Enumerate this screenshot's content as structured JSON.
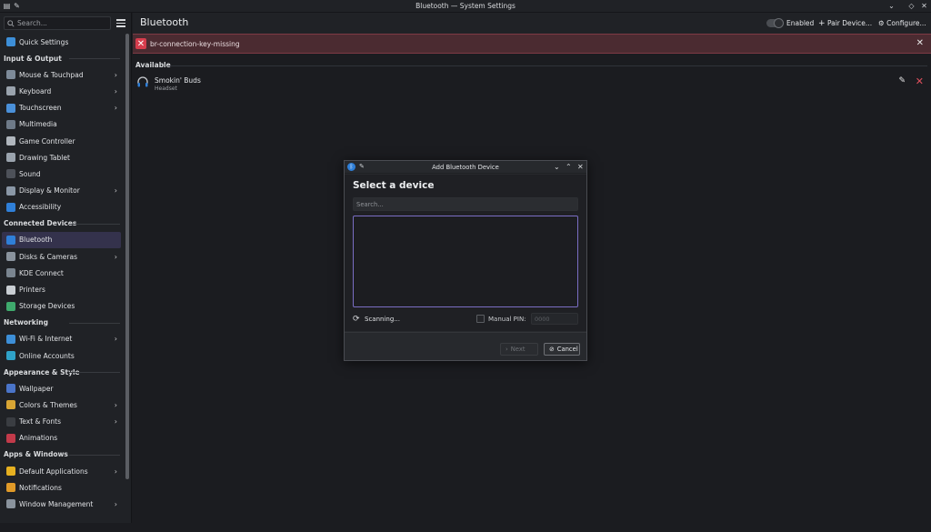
{
  "window": {
    "title": "Bluetooth — System Settings"
  },
  "sidebar": {
    "search_placeholder": "Search...",
    "groups": [
      {
        "section": "",
        "items": [
          {
            "label": "Quick Settings",
            "icon": "quick-settings-icon",
            "color": "#3d8fd8",
            "chevron": false
          }
        ]
      },
      {
        "section": "Input & Output",
        "items": [
          {
            "label": "Mouse & Touchpad",
            "icon": "mouse-icon",
            "color": "#7d8a99",
            "chevron": true
          },
          {
            "label": "Keyboard",
            "icon": "keyboard-icon",
            "color": "#9aa3ad",
            "chevron": true
          },
          {
            "label": "Touchscreen",
            "icon": "touchscreen-icon",
            "color": "#4a90d9",
            "chevron": true
          },
          {
            "label": "Multimedia",
            "icon": "multimedia-icon",
            "color": "#6e7a88",
            "chevron": false
          },
          {
            "label": "Game Controller",
            "icon": "gamepad-icon",
            "color": "#b0b6bd",
            "chevron": false
          },
          {
            "label": "Drawing Tablet",
            "icon": "tablet-icon",
            "color": "#9aa3ad",
            "chevron": false
          },
          {
            "label": "Sound",
            "icon": "sound-icon",
            "color": "#4d5159",
            "chevron": false
          },
          {
            "label": "Display & Monitor",
            "icon": "monitor-icon",
            "color": "#8a97a6",
            "chevron": true
          },
          {
            "label": "Accessibility",
            "icon": "accessibility-icon",
            "color": "#2f7fd8",
            "chevron": false
          }
        ]
      },
      {
        "section": "Connected Devices",
        "items": [
          {
            "label": "Bluetooth",
            "icon": "bluetooth-icon",
            "color": "#2f7fd8",
            "chevron": false,
            "active": true
          },
          {
            "label": "Disks & Cameras",
            "icon": "disk-icon",
            "color": "#8a939d",
            "chevron": true
          },
          {
            "label": "KDE Connect",
            "icon": "kde-connect-icon",
            "color": "#7a8590",
            "chevron": false
          },
          {
            "label": "Printers",
            "icon": "printer-icon",
            "color": "#c9ced3",
            "chevron": false
          },
          {
            "label": "Storage Devices",
            "icon": "storage-icon",
            "color": "#3faa6d",
            "chevron": false
          }
        ]
      },
      {
        "section": "Networking",
        "items": [
          {
            "label": "Wi-Fi & Internet",
            "icon": "network-icon",
            "color": "#3d8fd8",
            "chevron": true
          },
          {
            "label": "Online Accounts",
            "icon": "online-accounts-icon",
            "color": "#2fa2c8",
            "chevron": false
          }
        ]
      },
      {
        "section": "Appearance & Style",
        "items": [
          {
            "label": "Wallpaper",
            "icon": "wallpaper-icon",
            "color": "#4a74c9",
            "chevron": false
          },
          {
            "label": "Colors & Themes",
            "icon": "colors-icon",
            "color": "#d8a534",
            "chevron": true
          },
          {
            "label": "Text & Fonts",
            "icon": "fonts-icon",
            "color": "#3a3d42",
            "chevron": true
          },
          {
            "label": "Animations",
            "icon": "animations-icon",
            "color": "#c23a4a",
            "chevron": false
          }
        ]
      },
      {
        "section": "Apps & Windows",
        "items": [
          {
            "label": "Default Applications",
            "icon": "star-icon",
            "color": "#e6b020",
            "chevron": true
          },
          {
            "label": "Notifications",
            "icon": "bell-icon",
            "color": "#e09a28",
            "chevron": false
          },
          {
            "label": "Window Management",
            "icon": "window-icon",
            "color": "#8a939d",
            "chevron": true
          }
        ]
      }
    ]
  },
  "header": {
    "title": "Bluetooth",
    "toggle_label": "Enabled",
    "pair_label": "Pair Device...",
    "configure_label": "Configure..."
  },
  "banner": {
    "message": "br-connection-key-missing"
  },
  "content": {
    "section_label": "Available",
    "device": {
      "name": "Smokin' Buds",
      "type": "Headset"
    }
  },
  "dialog": {
    "title": "Add Bluetooth Device",
    "heading": "Select a device",
    "search_placeholder": "Search...",
    "scanning_label": "Scanning...",
    "manual_pin_label": "Manual PIN:",
    "pin_placeholder": "0000",
    "next_label": "Next",
    "cancel_label": "Cancel"
  }
}
